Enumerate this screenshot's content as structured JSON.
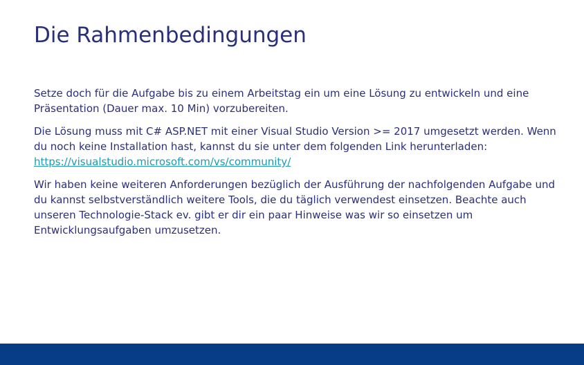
{
  "slide": {
    "title": "Die Rahmenbedingungen",
    "paragraph1": "Setze doch für die Aufgabe bis zu einem Arbeitstag ein um eine Lösung zu entwickeln und eine Präsentation (Dauer max. 10 Min) vorzubereiten.",
    "paragraph2": "Die Lösung muss mit C# ASP.NET mit einer Visual Studio Version >= 2017 umgesetzt werden. Wenn du noch keine Installation hast, kannst du sie unter dem folgenden Link herunterladen:",
    "link": "https://visualstudio.microsoft.com/vs/community/",
    "paragraph3": "Wir haben keine weiteren Anforderungen bezüglich der Ausführung der nachfolgenden Aufgabe und du kannst selbstverständlich weitere Tools, die du täglich verwendest einsetzen. Beachte auch unseren Technologie-Stack ev. gibt er dir ein paar Hinweise was wir so einsetzen um Entwicklungsaufgaben umzusetzen."
  },
  "colors": {
    "title": "#2a2f7a",
    "text": "#2a2f7a",
    "link": "#1a9bb1",
    "footer_bar": "#063d86"
  }
}
